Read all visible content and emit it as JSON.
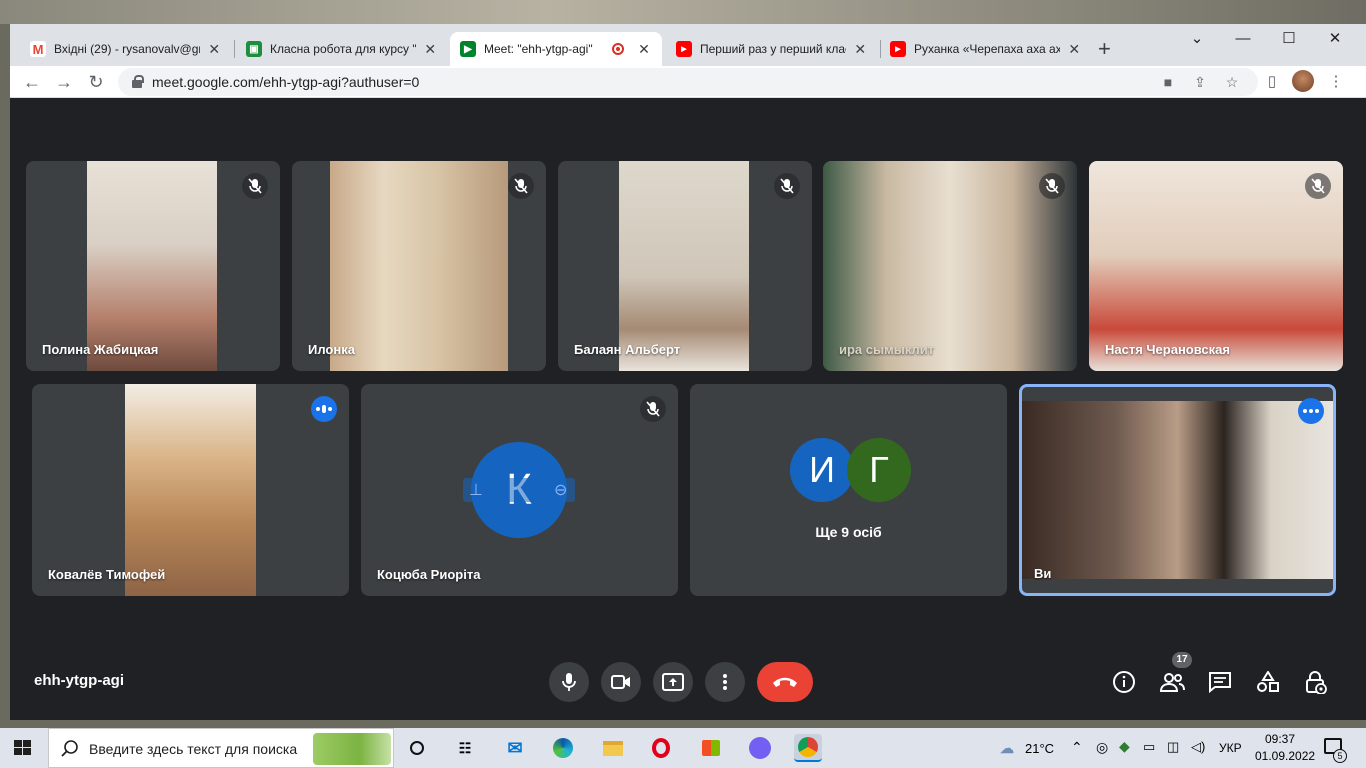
{
  "browser": {
    "tabs": [
      {
        "title": "Вхідні (29) - rysanovalv@gm",
        "icon": "gmail-icon"
      },
      {
        "title": "Класна робота для курсу \"Е",
        "icon": "classroom-icon"
      },
      {
        "title": "Meet: \"ehh-ytgp-agi\"",
        "icon": "meet-icon"
      },
      {
        "title": "Перший раз у перший клас",
        "icon": "youtube-icon"
      },
      {
        "title": "Руханка «Черепаха аха аха»",
        "icon": "youtube-icon"
      }
    ],
    "url": "meet.google.com/ehh-ytgp-agi?authuser=0"
  },
  "meet": {
    "participants": [
      {
        "name": "Полина Жабицкая",
        "muted": true
      },
      {
        "name": "Илонка",
        "muted": true
      },
      {
        "name": "Балаян Альберт",
        "muted": true
      },
      {
        "name": "ира сымыклит",
        "muted": true
      },
      {
        "name": "Настя Черановская",
        "muted": true
      },
      {
        "name": "Ковалёв Тимофей",
        "muted": false
      },
      {
        "name": "Коцюба Риоріта",
        "muted": true,
        "initial": "К"
      },
      {
        "name": "Ви",
        "muted": false
      }
    ],
    "others": {
      "initials": [
        "И",
        "Г"
      ],
      "label": "Ще 9 осіб"
    },
    "meeting_code": "ehh-ytgp-agi",
    "people_count": "17",
    "colors": {
      "accent": "#1a73e8",
      "end_call": "#ea4335",
      "tile": "#3c4043",
      "background": "#202124"
    }
  },
  "taskbar": {
    "search_placeholder": "Введите здесь текст для поиска",
    "weather": "21°C",
    "language": "УКР",
    "time": "09:37",
    "date": "01.09.2022",
    "notifications": "5"
  }
}
